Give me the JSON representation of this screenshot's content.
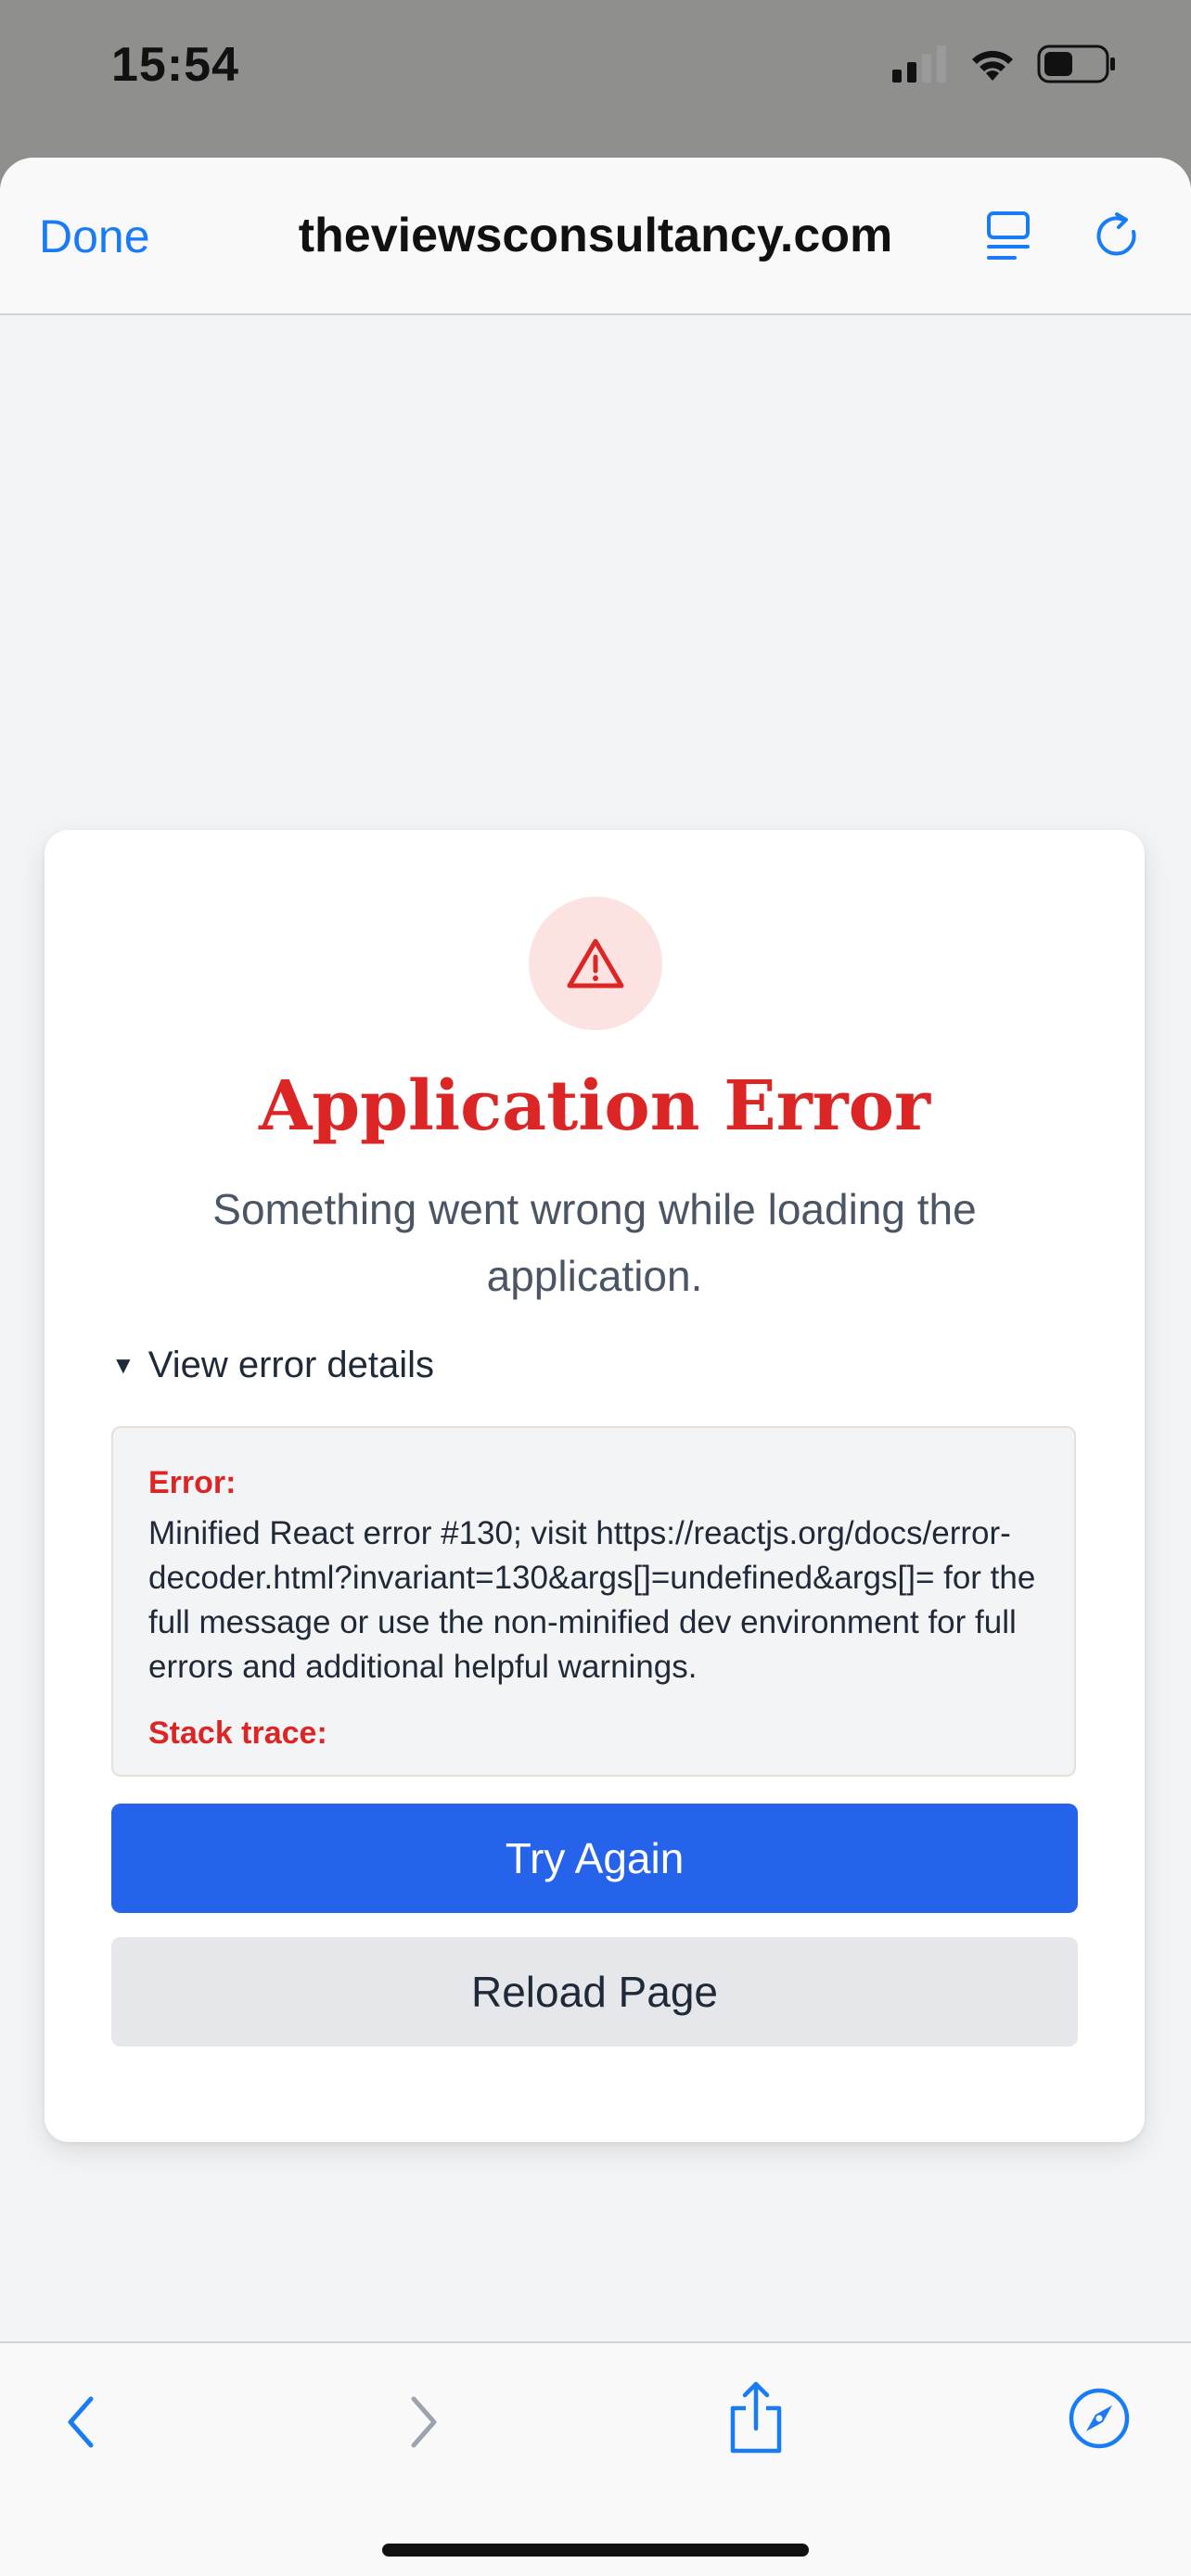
{
  "status_bar": {
    "time": "15:54",
    "icons": [
      "cellular-signal-icon",
      "wifi-icon",
      "battery-icon"
    ]
  },
  "navbar": {
    "done_label": "Done",
    "url": "theviewsconsultancy.com",
    "icons": [
      "reader-mode-icon",
      "reload-icon"
    ]
  },
  "error_card": {
    "icon": "warning-triangle-icon",
    "title": "Application Error",
    "subtitle": "Something went wrong while loading the application.",
    "details_toggle": "View error details",
    "error_label": "Error:",
    "error_message": "Minified React error #130; visit https://reactjs.org/docs/error-decoder.html?invariant=130&args[]=undefined&args[]= for the full message or use the non-minified dev environment for full errors and additional helpful warnings.",
    "stack_label": "Stack trace:",
    "primary_button": "Try Again",
    "secondary_button": "Reload Page"
  },
  "toolbar": {
    "icons": [
      "back-chevron-icon",
      "forward-chevron-icon",
      "share-icon",
      "compass-icon"
    ]
  },
  "colors": {
    "accent": "#1a7cf5",
    "error": "#dc2626",
    "primary_button": "#2563eb",
    "secondary_button": "#e5e7eb"
  }
}
